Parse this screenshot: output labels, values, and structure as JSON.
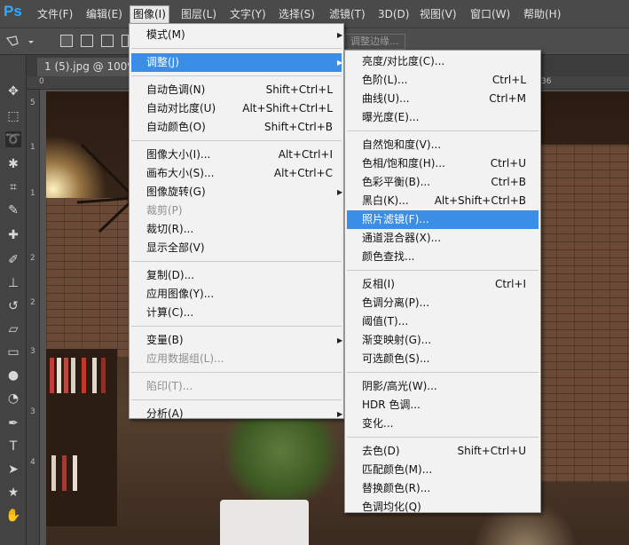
{
  "app": {
    "logo": "Ps"
  },
  "menubar": [
    {
      "label": "文件(F)"
    },
    {
      "label": "编辑(E)"
    },
    {
      "label": "图像(I)"
    },
    {
      "label": "图层(L)"
    },
    {
      "label": "文字(Y)"
    },
    {
      "label": "选择(S)"
    },
    {
      "label": "滤镜(T)"
    },
    {
      "label": "3D(D)"
    },
    {
      "label": "视图(V)"
    },
    {
      "label": "窗口(W)"
    },
    {
      "label": "帮助(H)"
    }
  ],
  "options_bar": {
    "refine_edge": "调整边缘..."
  },
  "document": {
    "tab_title": "1 (5).jpg @ 100% ("
  },
  "rulers": {
    "h_marks": [
      "0",
      "36"
    ],
    "v_marks": [
      "5",
      "1",
      "1",
      "2",
      "2",
      "3",
      "3",
      "4"
    ]
  },
  "image_menu": [
    {
      "label": "模式(M)",
      "shortcut": "",
      "submenu": true
    },
    {
      "separator": true
    },
    {
      "label": "调整(J)",
      "shortcut": "",
      "submenu": true,
      "highlighted": true
    },
    {
      "separator": true
    },
    {
      "label": "自动色调(N)",
      "shortcut": "Shift+Ctrl+L"
    },
    {
      "label": "自动对比度(U)",
      "shortcut": "Alt+Shift+Ctrl+L"
    },
    {
      "label": "自动颜色(O)",
      "shortcut": "Shift+Ctrl+B"
    },
    {
      "separator": true
    },
    {
      "label": "图像大小(I)...",
      "shortcut": "Alt+Ctrl+I"
    },
    {
      "label": "画布大小(S)...",
      "shortcut": "Alt+Ctrl+C"
    },
    {
      "label": "图像旋转(G)",
      "shortcut": "",
      "submenu": true
    },
    {
      "label": "裁剪(P)",
      "shortcut": "",
      "disabled": true
    },
    {
      "label": "裁切(R)...",
      "shortcut": ""
    },
    {
      "label": "显示全部(V)",
      "shortcut": ""
    },
    {
      "separator": true
    },
    {
      "label": "复制(D)...",
      "shortcut": ""
    },
    {
      "label": "应用图像(Y)...",
      "shortcut": ""
    },
    {
      "label": "计算(C)...",
      "shortcut": ""
    },
    {
      "separator": true
    },
    {
      "label": "变量(B)",
      "shortcut": "",
      "submenu": true
    },
    {
      "label": "应用数据组(L)...",
      "shortcut": "",
      "disabled": true
    },
    {
      "separator": true
    },
    {
      "label": "陷印(T)...",
      "shortcut": "",
      "disabled": true
    },
    {
      "separator": true
    },
    {
      "label": "分析(A)",
      "shortcut": "",
      "submenu": true
    }
  ],
  "adjust_menu": [
    {
      "label": "亮度/对比度(C)...",
      "shortcut": ""
    },
    {
      "label": "色阶(L)...",
      "shortcut": "Ctrl+L"
    },
    {
      "label": "曲线(U)...",
      "shortcut": "Ctrl+M"
    },
    {
      "label": "曝光度(E)...",
      "shortcut": ""
    },
    {
      "separator": true
    },
    {
      "label": "自然饱和度(V)...",
      "shortcut": ""
    },
    {
      "label": "色相/饱和度(H)...",
      "shortcut": "Ctrl+U"
    },
    {
      "label": "色彩平衡(B)...",
      "shortcut": "Ctrl+B"
    },
    {
      "label": "黑白(K)...",
      "shortcut": "Alt+Shift+Ctrl+B"
    },
    {
      "label": "照片滤镜(F)...",
      "shortcut": "",
      "highlighted": true
    },
    {
      "label": "通道混合器(X)...",
      "shortcut": ""
    },
    {
      "label": "颜色查找...",
      "shortcut": ""
    },
    {
      "separator": true
    },
    {
      "label": "反相(I)",
      "shortcut": "Ctrl+I"
    },
    {
      "label": "色调分离(P)...",
      "shortcut": ""
    },
    {
      "label": "阈值(T)...",
      "shortcut": ""
    },
    {
      "label": "渐变映射(G)...",
      "shortcut": ""
    },
    {
      "label": "可选颜色(S)...",
      "shortcut": ""
    },
    {
      "separator": true
    },
    {
      "label": "阴影/高光(W)...",
      "shortcut": ""
    },
    {
      "label": "HDR 色调...",
      "shortcut": ""
    },
    {
      "label": "变化...",
      "shortcut": ""
    },
    {
      "separator": true
    },
    {
      "label": "去色(D)",
      "shortcut": "Shift+Ctrl+U"
    },
    {
      "label": "匹配颜色(M)...",
      "shortcut": ""
    },
    {
      "label": "替换颜色(R)...",
      "shortcut": ""
    },
    {
      "label": "色调均化(Q)",
      "shortcut": ""
    }
  ],
  "tools": [
    "move-tool",
    "marquee-tool",
    "lasso-tool",
    "magic-wand-tool",
    "crop-tool",
    "eyedropper-tool",
    "healing-brush-tool",
    "brush-tool",
    "clone-stamp-tool",
    "history-brush-tool",
    "eraser-tool",
    "gradient-tool",
    "blur-tool",
    "dodge-tool",
    "pen-tool",
    "type-tool",
    "path-selection-tool",
    "shape-tool",
    "hand-tool"
  ]
}
